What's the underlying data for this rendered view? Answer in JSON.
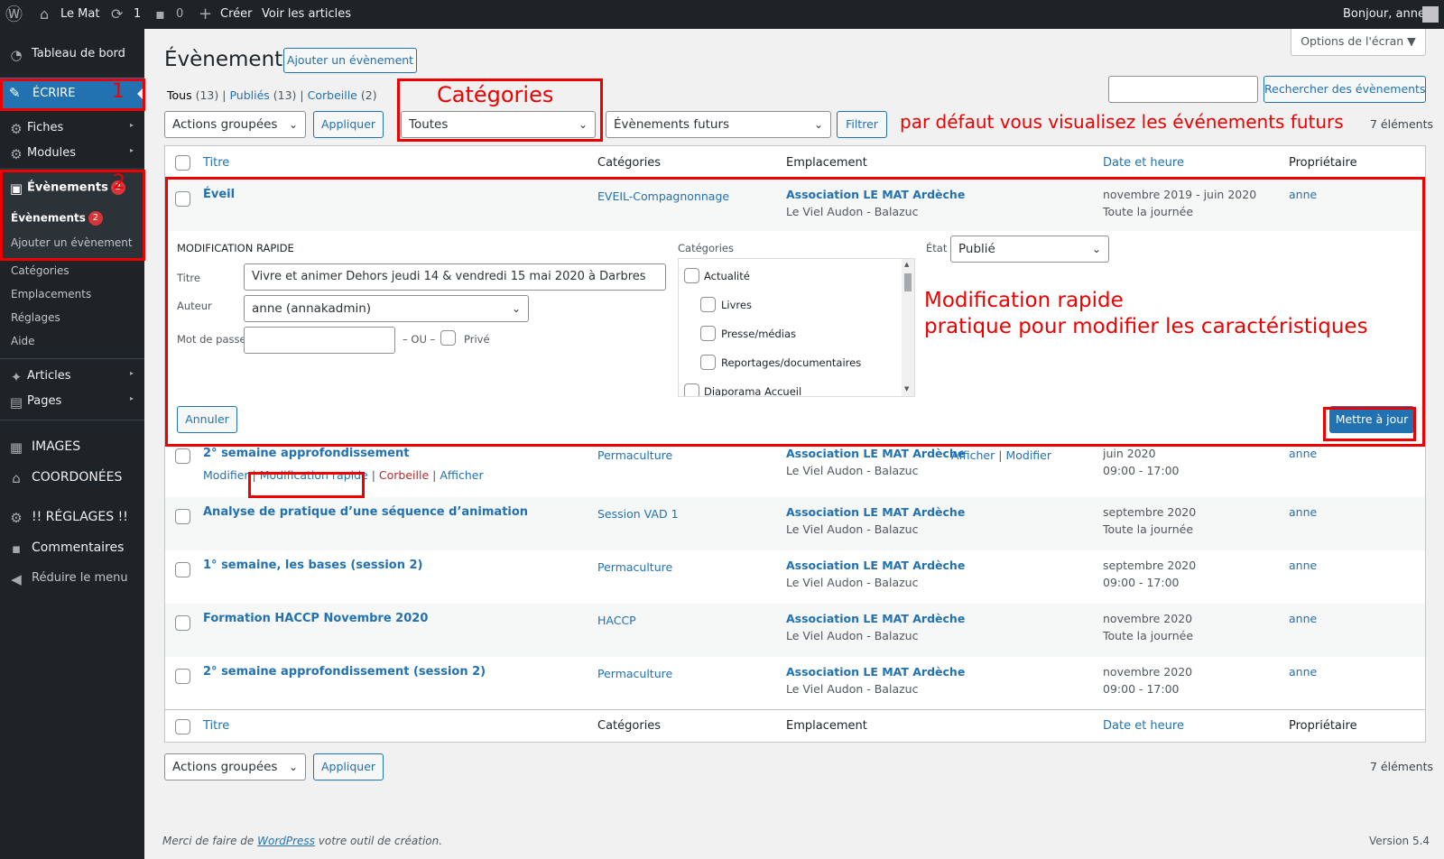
{
  "adminbar": {
    "site_name": "Le Mat",
    "updates_count": "1",
    "comments_count": "0",
    "new_label": "Créer",
    "view_label": "Voir les articles",
    "greeting": "Bonjour, anne"
  },
  "sidebar": {
    "dashboard": "Tableau de bord",
    "write": "ÉCRIRE",
    "fiches": "Fiches",
    "modules": "Modules",
    "events": "Évènements",
    "events_badge": "2",
    "sub_events": "Évènements",
    "sub_add": "Ajouter un évènement",
    "sub_categories": "Catégories",
    "sub_locations": "Emplacements",
    "sub_settings": "Réglages",
    "sub_help": "Aide",
    "articles": "Articles",
    "pages": "Pages",
    "images": "IMAGES",
    "coordonnees": "COORDONÉES",
    "reglages": "!! RÉGLAGES !!",
    "comments": "Commentaires",
    "collapse": "Réduire le menu"
  },
  "annotations": {
    "n1": "1",
    "n2": "2",
    "categories": "Catégories",
    "future": "par défaut vous visualisez les événements futurs",
    "quick1": "Modification rapide",
    "quick2": "pratique pour modifier les caractéristiques"
  },
  "page": {
    "title": "Évènements",
    "add_button": "Ajouter un évènement",
    "screen_options": "Options de l'écran ▼",
    "search_button": "Rechercher des évènements",
    "views": {
      "all": "Tous",
      "all_count": "(13)",
      "sep1": "|",
      "published": "Publiés",
      "published_count": "(13)",
      "sep2": "|",
      "trash": "Corbeille",
      "trash_count": "(2)"
    },
    "bulk_actions": "Actions groupées",
    "apply": "Appliquer",
    "category_filter": "Toutes",
    "time_filter": "Évènements futurs",
    "filter": "Filtrer",
    "count": "7 éléments"
  },
  "table": {
    "columns": {
      "title": "Titre",
      "categories": "Catégories",
      "location": "Emplacement",
      "date": "Date et heure",
      "owner": "Propriétaire"
    },
    "first_row": {
      "title": "Éveil",
      "category": "EVEIL-Compagnonnage",
      "location": "Association LE MAT Ardèche",
      "location_sub": "Le Viel Audon - Balazuc",
      "date": "novembre 2019 - juin 2020",
      "time": "Toute la journée",
      "owner": "anne"
    },
    "quick_edit": {
      "heading": "MODIFICATION RAPIDE",
      "title_label": "Titre",
      "title_value": "Vivre et animer Dehors jeudi 14 & vendredi 15 mai 2020 à Darbres",
      "author_label": "Auteur",
      "author_value": "anne (annakadmin)",
      "password_label": "Mot de passe",
      "or_label": "– OU –",
      "private_label": "Privé",
      "categories_label": "Catégories",
      "cats": [
        "Actualité",
        "Livres",
        "Presse/médias",
        "Reportages/documentaires",
        "Diaporama Accueil"
      ],
      "state_label": "État",
      "state_value": "Publié",
      "cancel": "Annuler",
      "update": "Mettre à jour"
    },
    "rows": [
      {
        "title": "2° semaine approfondissement",
        "category": "Permaculture",
        "location": "Association LE MAT Ardèche",
        "location_sub": "Le Viel Audon - Balazuc",
        "date": "juin 2020",
        "time": "09:00 - 17:00",
        "owner": "anne"
      },
      {
        "title": "Analyse de pratique d’une séquence d’animation",
        "category": "Session VAD 1",
        "location": "Association LE MAT Ardèche",
        "location_sub": "Le Viel Audon - Balazuc",
        "date": "septembre 2020",
        "time": "Toute la journée",
        "owner": "anne"
      },
      {
        "title": "1° semaine, les bases (session 2)",
        "category": "Permaculture",
        "location": "Association LE MAT Ardèche",
        "location_sub": "Le Viel Audon - Balazuc",
        "date": "septembre 2020",
        "time": "09:00 - 17:00",
        "owner": "anne"
      },
      {
        "title": "Formation HACCP Novembre 2020",
        "category": "HACCP",
        "location": "Association LE MAT Ardèche",
        "location_sub": "Le Viel Audon - Balazuc",
        "date": "novembre 2020",
        "time": "Toute la journée",
        "owner": "anne"
      },
      {
        "title": "2° semaine approfondissement (session 2)",
        "category": "Permaculture",
        "location": "Association LE MAT Ardèche",
        "location_sub": "Le Viel Audon - Balazuc",
        "date": "novembre 2020",
        "time": "09:00 - 17:00",
        "owner": "anne"
      }
    ],
    "row_actions": {
      "edit": "Modifier",
      "quick": "Modification rapide",
      "trash": "Corbeille",
      "view": "Afficher",
      "loc_view": "Afficher",
      "loc_edit": "Modifier"
    }
  },
  "footer": {
    "thanks": "Merci de faire de",
    "wp": "WordPress",
    "thanks_end": "votre outil de création.",
    "version": "Version 5.4"
  }
}
